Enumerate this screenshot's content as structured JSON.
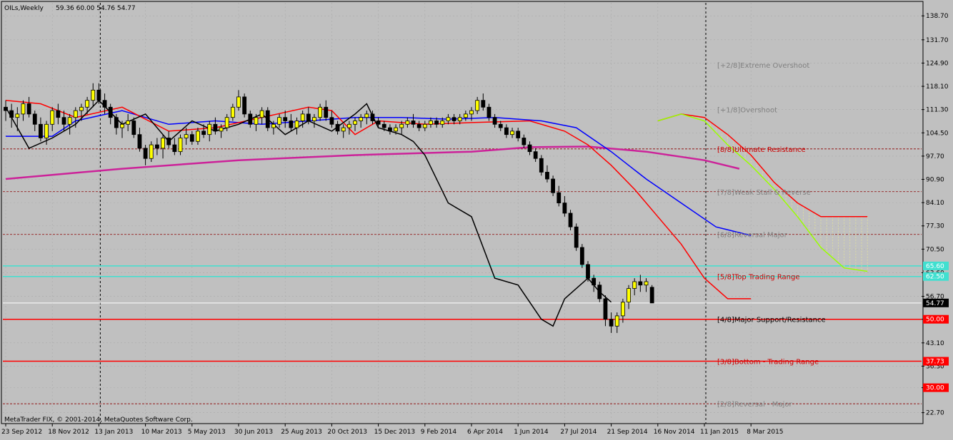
{
  "header": {
    "symbol_label": "OILs,Weekly",
    "ohlc_values": "59.36 60.00 54.76 54.77"
  },
  "footer": {
    "copyright": "MetaTrader FIX, © 2001-2014, MetaQuotes Software Corp."
  },
  "colors": {
    "background": "#c0c0c0",
    "bull_candle": "#ffff00",
    "bear_candle": "#000000",
    "murrey_line": "#ff0000",
    "murrey_text": "#808080",
    "murrey_text_dark": "#000000",
    "cyan_line": "#40e0d0",
    "magenta_ma": "#cc2299",
    "blue_line": "#0000ff",
    "lime_line": "#99ff00",
    "red_line": "#ff0000",
    "black_line": "#000000"
  },
  "chart_data": {
    "type": "candlestick",
    "symbol": "OILs",
    "timeframe": "Weekly",
    "ylim": [
      19.5,
      142.5
    ],
    "y_ticks": [
      138.7,
      131.7,
      124.9,
      118.1,
      111.3,
      104.5,
      97.7,
      90.9,
      84.1,
      77.3,
      70.5,
      63.6,
      56.7,
      50.0,
      43.1,
      36.3,
      30.0,
      22.7
    ],
    "y_tick_labels": [
      "138.70",
      "131.70",
      "124.90",
      "118.10",
      "111.30",
      "104.50",
      "97.70",
      "90.90",
      "84.10",
      "77.30",
      "70.50",
      "63.60",
      "56.70",
      "50.00",
      "43.10",
      "36.30",
      "30.00",
      "22.70"
    ],
    "x_labels": [
      "23 Sep 2012",
      "18 Nov 2012",
      "13 Jan 2013",
      "10 Mar 2013",
      "5 May 2013",
      "30 Jun 2013",
      "25 Aug 2013",
      "20 Oct 2013",
      "15 Dec 2013",
      "9 Feb 2014",
      "6 Apr 2014",
      "1 Jun 2014",
      "27 Jul 2014",
      "21 Sep 2014",
      "16 Nov 2014",
      "11 Jan 2015",
      "8 Mar 2015"
    ],
    "x_label_index": [
      0,
      8,
      16,
      24,
      32,
      40,
      48,
      56,
      64,
      72,
      80,
      88,
      96,
      104,
      112,
      120,
      128
    ],
    "vertical_separators": [
      "13 Jan 2013",
      "11 Jan 2015"
    ],
    "current_price": 54.77,
    "current_price_label": "54.77",
    "price_tags": [
      {
        "value": 50.0,
        "label": "50.00",
        "color": "#ff0000"
      },
      {
        "value": 37.73,
        "label": "37.73",
        "color": "#ff0000"
      },
      {
        "value": 30.0,
        "label": "30.00",
        "color": "#ff0000"
      },
      {
        "value": 65.6,
        "label": "65.60",
        "color": "#40e0d0"
      },
      {
        "value": 62.5,
        "label": "62.50",
        "color": "#40e0d0"
      }
    ],
    "murrey_levels": [
      {
        "label": "[+2/8]Extreme Overshoot",
        "value": 124.4,
        "text_color": "#808080",
        "line": "none"
      },
      {
        "label": "[+1/8]Overshoot",
        "value": 111.3,
        "text_color": "#808080",
        "line": "none"
      },
      {
        "label": "[8/8]Ultimate Resistance",
        "value": 99.8,
        "text_color": "#cc0000",
        "line": "dashed"
      },
      {
        "label": "[7/8]Weak Stall & Reverse",
        "value": 87.3,
        "text_color": "#808080",
        "line": "dashed"
      },
      {
        "label": "[6/8]Reversal Major",
        "value": 74.8,
        "text_color": "#808080",
        "line": "dashed"
      },
      {
        "label": "[5/8]Top Trading Range",
        "value": 62.5,
        "text_color": "#cc0000",
        "line": "dashed"
      },
      {
        "label": "[4/8]Major Support/Resistance",
        "value": 50.0,
        "text_color": "#000000",
        "line": "solid"
      },
      {
        "label": "[3/8]Bottom - Trading Range",
        "value": 37.73,
        "text_color": "#cc0000",
        "line": "solid"
      },
      {
        "label": "[2/8]Reversal - Major",
        "value": 25.3,
        "text_color": "#808080",
        "line": "dashed"
      }
    ],
    "candles_ohlc": [
      [
        112,
        114,
        108,
        111
      ],
      [
        111,
        113,
        106,
        109
      ],
      [
        109,
        112,
        105,
        110
      ],
      [
        110,
        114,
        108,
        113
      ],
      [
        113,
        115,
        109,
        110
      ],
      [
        110,
        111,
        105,
        107
      ],
      [
        107,
        109,
        102,
        103
      ],
      [
        103,
        108,
        101,
        107
      ],
      [
        107,
        112,
        105,
        111
      ],
      [
        111,
        113,
        107,
        109
      ],
      [
        109,
        111,
        105,
        107
      ],
      [
        107,
        110,
        104,
        109
      ],
      [
        109,
        112,
        106,
        111
      ],
      [
        111,
        113,
        108,
        112
      ],
      [
        112,
        115,
        110,
        114
      ],
      [
        114,
        119,
        112,
        117
      ],
      [
        117,
        119,
        113,
        114
      ],
      [
        114,
        116,
        110,
        112
      ],
      [
        112,
        113,
        107,
        109
      ],
      [
        109,
        110,
        104,
        106
      ],
      [
        106,
        108,
        103,
        107
      ],
      [
        107,
        110,
        105,
        108
      ],
      [
        108,
        109,
        103,
        104
      ],
      [
        104,
        106,
        99,
        100
      ],
      [
        100,
        101,
        95,
        97
      ],
      [
        97,
        102,
        96,
        101
      ],
      [
        101,
        103,
        98,
        100
      ],
      [
        100,
        104,
        97,
        103
      ],
      [
        103,
        105,
        100,
        101
      ],
      [
        101,
        103,
        98,
        99
      ],
      [
        99,
        104,
        98,
        103
      ],
      [
        103,
        106,
        101,
        104
      ],
      [
        104,
        105,
        101,
        102
      ],
      [
        102,
        106,
        101,
        105
      ],
      [
        105,
        107,
        103,
        104
      ],
      [
        104,
        108,
        102,
        107
      ],
      [
        107,
        109,
        104,
        105
      ],
      [
        105,
        107,
        103,
        106
      ],
      [
        106,
        110,
        105,
        109
      ],
      [
        109,
        113,
        108,
        112
      ],
      [
        112,
        117,
        111,
        115
      ],
      [
        115,
        116,
        109,
        110
      ],
      [
        110,
        111,
        106,
        107
      ],
      [
        107,
        110,
        105,
        109
      ],
      [
        109,
        112,
        107,
        111
      ],
      [
        111,
        112,
        105,
        106
      ],
      [
        106,
        108,
        104,
        107
      ],
      [
        107,
        110,
        106,
        109
      ],
      [
        109,
        111,
        106,
        108
      ],
      [
        108,
        110,
        105,
        106
      ],
      [
        106,
        109,
        104,
        108
      ],
      [
        108,
        111,
        106,
        110
      ],
      [
        110,
        112,
        107,
        108
      ],
      [
        108,
        110,
        106,
        109
      ],
      [
        109,
        113,
        108,
        112
      ],
      [
        112,
        114,
        108,
        109
      ],
      [
        109,
        111,
        106,
        107
      ],
      [
        107,
        108,
        104,
        105
      ],
      [
        105,
        107,
        103,
        106
      ],
      [
        106,
        108,
        104,
        107
      ],
      [
        107,
        109,
        105,
        108
      ],
      [
        108,
        110,
        106,
        109
      ],
      [
        109,
        111,
        107,
        110
      ],
      [
        110,
        111,
        107,
        108
      ],
      [
        108,
        109,
        106,
        107
      ],
      [
        107,
        108,
        105,
        106
      ],
      [
        106,
        107,
        104,
        105
      ],
      [
        105,
        107,
        104,
        106
      ],
      [
        106,
        108,
        104,
        107
      ],
      [
        107,
        109,
        106,
        108
      ],
      [
        108,
        110,
        106,
        107
      ],
      [
        107,
        108,
        105,
        106
      ],
      [
        106,
        108,
        105,
        107
      ],
      [
        107,
        109,
        106,
        108
      ],
      [
        108,
        109,
        106,
        107
      ],
      [
        107,
        109,
        106,
        108
      ],
      [
        108,
        110,
        107,
        109
      ],
      [
        109,
        110,
        107,
        108
      ],
      [
        108,
        110,
        107,
        109
      ],
      [
        109,
        111,
        108,
        110
      ],
      [
        110,
        112,
        108,
        111
      ],
      [
        111,
        115,
        110,
        114
      ],
      [
        114,
        116,
        111,
        112
      ],
      [
        112,
        113,
        108,
        109
      ],
      [
        109,
        110,
        106,
        107
      ],
      [
        107,
        108,
        105,
        106
      ],
      [
        106,
        107,
        103,
        104
      ],
      [
        104,
        106,
        103,
        105
      ],
      [
        105,
        106,
        102,
        103
      ],
      [
        103,
        104,
        100,
        101
      ],
      [
        101,
        102,
        98,
        99
      ],
      [
        99,
        100,
        96,
        97
      ],
      [
        97,
        98,
        92,
        93
      ],
      [
        93,
        95,
        90,
        91
      ],
      [
        91,
        92,
        86,
        87
      ],
      [
        87,
        89,
        83,
        84
      ],
      [
        84,
        86,
        80,
        81
      ],
      [
        81,
        82,
        76,
        77
      ],
      [
        77,
        78,
        70,
        71
      ],
      [
        71,
        72,
        65,
        66
      ],
      [
        66,
        67,
        61,
        62
      ],
      [
        62,
        63,
        58,
        60
      ],
      [
        60,
        61,
        55,
        56
      ],
      [
        56,
        57,
        48,
        50
      ],
      [
        50,
        52,
        46,
        48
      ],
      [
        48,
        52,
        46,
        51
      ],
      [
        51,
        56,
        49,
        55
      ],
      [
        55,
        60,
        53,
        59
      ],
      [
        59,
        62,
        57,
        61
      ],
      [
        61,
        63,
        58,
        60
      ],
      [
        60,
        62,
        58,
        61
      ],
      [
        59.36,
        60.0,
        54.76,
        54.77
      ]
    ],
    "lines": {
      "magenta_ma": [
        [
          0,
          91
        ],
        [
          20,
          94
        ],
        [
          40,
          96.5
        ],
        [
          60,
          98
        ],
        [
          80,
          99
        ],
        [
          90,
          100.3
        ],
        [
          100,
          100.5
        ],
        [
          110,
          99
        ],
        [
          120,
          96.5
        ],
        [
          126,
          94
        ]
      ],
      "blue": [
        [
          0,
          103.5
        ],
        [
          8,
          103.5
        ],
        [
          12,
          108
        ],
        [
          20,
          111
        ],
        [
          28,
          107
        ],
        [
          36,
          108
        ],
        [
          44,
          107
        ],
        [
          52,
          108
        ],
        [
          60,
          109
        ],
        [
          68,
          109
        ],
        [
          76,
          108.5
        ],
        [
          84,
          109
        ],
        [
          92,
          108
        ],
        [
          98,
          106
        ],
        [
          104,
          99
        ],
        [
          110,
          91
        ],
        [
          116,
          84
        ],
        [
          122,
          77
        ],
        [
          128,
          74.5
        ]
      ],
      "red": [
        [
          0,
          114
        ],
        [
          6,
          113
        ],
        [
          12,
          109
        ],
        [
          20,
          112
        ],
        [
          28,
          105
        ],
        [
          36,
          106
        ],
        [
          44,
          109
        ],
        [
          52,
          112
        ],
        [
          56,
          111
        ],
        [
          60,
          104
        ],
        [
          64,
          108
        ],
        [
          72,
          107
        ],
        [
          80,
          107.5
        ],
        [
          90,
          108
        ],
        [
          96,
          105
        ],
        [
          100,
          101
        ],
        [
          104,
          95
        ],
        [
          108,
          88
        ],
        [
          112,
          80
        ],
        [
          116,
          72
        ],
        [
          120,
          62
        ],
        [
          124,
          56
        ],
        [
          128,
          56
        ]
      ],
      "black": [
        [
          0,
          112
        ],
        [
          4,
          100
        ],
        [
          8,
          103
        ],
        [
          12,
          107
        ],
        [
          16,
          114
        ],
        [
          20,
          107
        ],
        [
          24,
          110
        ],
        [
          28,
          102
        ],
        [
          32,
          108
        ],
        [
          36,
          105
        ],
        [
          40,
          107
        ],
        [
          44,
          110
        ],
        [
          48,
          104
        ],
        [
          52,
          108
        ],
        [
          56,
          105
        ],
        [
          60,
          110
        ],
        [
          62,
          113
        ],
        [
          64,
          106
        ],
        [
          68,
          104
        ],
        [
          70,
          102
        ],
        [
          72,
          98
        ],
        [
          76,
          84
        ],
        [
          80,
          80
        ],
        [
          84,
          62
        ],
        [
          88,
          60
        ],
        [
          92,
          50
        ],
        [
          94,
          48
        ],
        [
          96,
          56
        ],
        [
          100,
          62
        ],
        [
          102,
          58
        ],
        [
          104,
          55
        ]
      ],
      "red_future": [
        [
          112,
          108
        ],
        [
          116,
          110
        ],
        [
          120,
          109
        ],
        [
          124,
          104
        ],
        [
          128,
          98
        ],
        [
          132,
          90
        ],
        [
          136,
          84
        ],
        [
          140,
          80
        ],
        [
          144,
          80
        ],
        [
          148,
          80
        ]
      ],
      "lime_future": [
        [
          112,
          108
        ],
        [
          116,
          110
        ],
        [
          120,
          108
        ],
        [
          124,
          101
        ],
        [
          128,
          95
        ],
        [
          132,
          88
        ],
        [
          136,
          80
        ],
        [
          140,
          71
        ],
        [
          144,
          65
        ],
        [
          148,
          64
        ]
      ]
    }
  }
}
